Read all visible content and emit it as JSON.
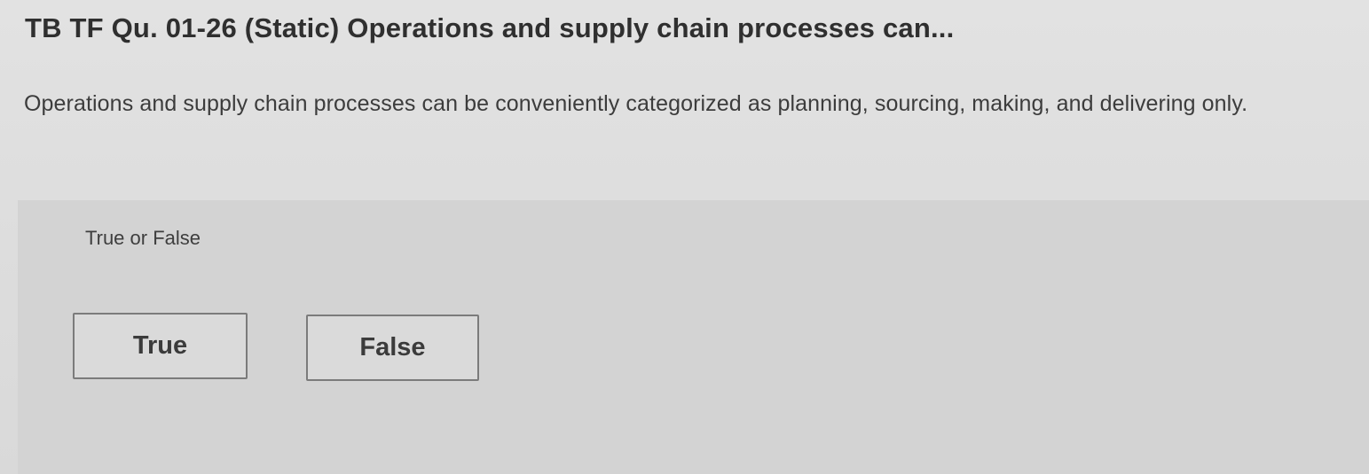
{
  "question": {
    "title": "TB TF Qu. 01-26 (Static) Operations and supply chain processes can...",
    "text": "Operations and supply chain processes can be conveniently categorized as planning, sourcing, making, and delivering only."
  },
  "answer": {
    "type_label": "True or False",
    "options": [
      {
        "label": "True"
      },
      {
        "label": "False"
      }
    ]
  }
}
